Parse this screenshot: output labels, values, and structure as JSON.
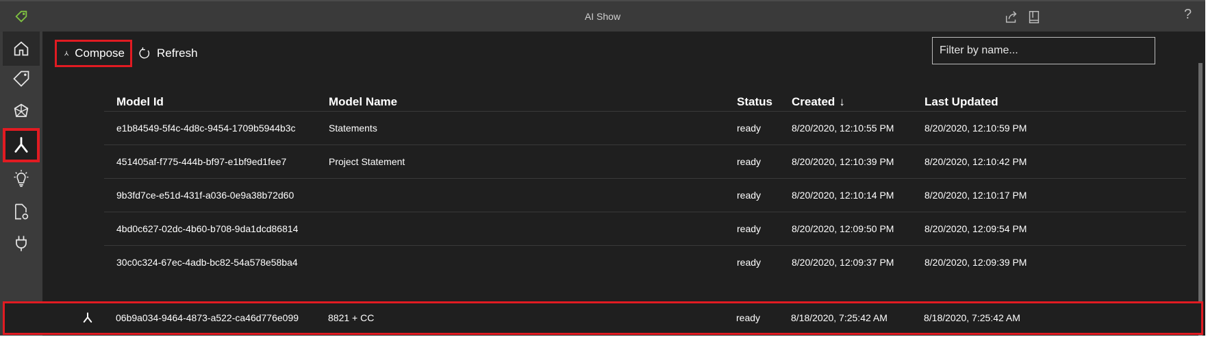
{
  "window": {
    "title": "AI Show",
    "help_label": "?"
  },
  "toolbar": {
    "compose_label": "Compose",
    "refresh_label": "Refresh",
    "filter_placeholder": "Filter by name..."
  },
  "table": {
    "headers": {
      "model_id": "Model Id",
      "model_name": "Model Name",
      "status": "Status",
      "created": "Created",
      "created_sort": "↓",
      "last_updated": "Last Updated"
    },
    "rows": [
      {
        "model_id": "e1b84549-5f4c-4d8c-9454-1709b5944b3c",
        "model_name": "Statements",
        "status": "ready",
        "created": "8/20/2020, 12:10:55 PM",
        "last_updated": "8/20/2020, 12:10:59 PM"
      },
      {
        "model_id": "451405af-f775-444b-bf97-e1bf9ed1fee7",
        "model_name": "Project Statement",
        "status": "ready",
        "created": "8/20/2020, 12:10:39 PM",
        "last_updated": "8/20/2020, 12:10:42 PM"
      },
      {
        "model_id": "9b3fd7ce-e51d-431f-a036-0e9a38b72d60",
        "model_name": "",
        "status": "ready",
        "created": "8/20/2020, 12:10:14 PM",
        "last_updated": "8/20/2020, 12:10:17 PM"
      },
      {
        "model_id": "4bd0c627-02dc-4b60-b708-9da1dcd86814",
        "model_name": "",
        "status": "ready",
        "created": "8/20/2020, 12:09:50 PM",
        "last_updated": "8/20/2020, 12:09:54 PM"
      },
      {
        "model_id": "30c0c324-67ec-4adb-bc82-54a578e58ba4",
        "model_name": "",
        "status": "ready",
        "created": "8/20/2020, 12:09:37 PM",
        "last_updated": "8/20/2020, 12:09:39 PM"
      }
    ],
    "selected_row": {
      "model_id": "06b9a034-9464-4873-a522-ca46d776e099",
      "model_name": "8821 + CC",
      "status": "ready",
      "created": "8/18/2020, 7:25:42 AM",
      "last_updated": "8/18/2020, 7:25:42 AM"
    }
  },
  "nav": {
    "items": [
      "home-icon",
      "tag-icon",
      "model-icon",
      "compose-icon",
      "lightbulb-icon",
      "document-settings-icon",
      "plug-icon",
      "gear-icon"
    ],
    "active": "compose-icon"
  },
  "colors": {
    "accent": "#e11b22",
    "background": "#1f1f1f",
    "titlebar": "#3a3a3a",
    "nav": "#3b3b3b",
    "logo": "#7fc241"
  }
}
